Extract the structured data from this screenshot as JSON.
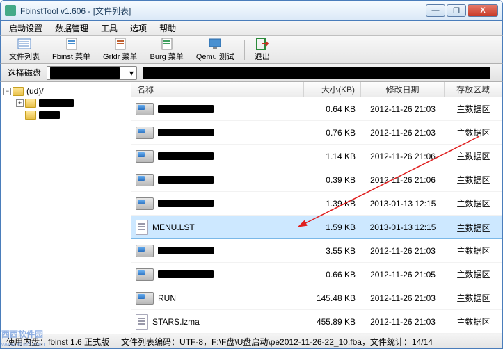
{
  "window": {
    "title": "FbinstTool v1.606 - [文件列表]",
    "min": "—",
    "max": "❐",
    "close": "X"
  },
  "menu": {
    "start": "启动设置",
    "data": "数据管理",
    "tools": "工具",
    "options": "选项",
    "help": "帮助"
  },
  "toolbar": {
    "filelist": "文件列表",
    "fbinst": "Fbinst 菜单",
    "grldr": "Grldr 菜单",
    "burg": "Burg 菜单",
    "qemu": "Qemu 测试",
    "exit": "退出"
  },
  "disk": {
    "label": "选择磁盘",
    "chevron": "▾"
  },
  "tree": {
    "root": "(ud)/",
    "minus": "−",
    "plus": "+"
  },
  "columns": {
    "name": "名称",
    "size": "大小(KB)",
    "date": "修改日期",
    "store": "存放区域"
  },
  "rows": [
    {
      "icon": "drive",
      "masked": true,
      "name": "",
      "size": "0.64 KB",
      "date": "2012-11-26 21:03",
      "store": "主数据区",
      "selected": false
    },
    {
      "icon": "drive",
      "masked": true,
      "name": "",
      "size": "0.76 KB",
      "date": "2012-11-26 21:03",
      "store": "主数据区",
      "selected": false
    },
    {
      "icon": "drive",
      "masked": true,
      "name": "",
      "size": "1.14 KB",
      "date": "2012-11-26 21:06",
      "store": "主数据区",
      "selected": false
    },
    {
      "icon": "drive",
      "masked": true,
      "name": "",
      "size": "0.39 KB",
      "date": "2012-11-26 21:06",
      "store": "主数据区",
      "selected": false
    },
    {
      "icon": "drive",
      "masked": true,
      "name": "",
      "size": "1.39 KB",
      "date": "2013-01-13 12:15",
      "store": "主数据区",
      "selected": false
    },
    {
      "icon": "doc",
      "masked": false,
      "name": "MENU.LST",
      "size": "1.59 KB",
      "date": "2013-01-13 12:15",
      "store": "主数据区",
      "selected": true
    },
    {
      "icon": "drive",
      "masked": true,
      "name": "",
      "size": "3.55 KB",
      "date": "2012-11-26 21:03",
      "store": "主数据区",
      "selected": false
    },
    {
      "icon": "drive",
      "masked": true,
      "name": "",
      "size": "0.66 KB",
      "date": "2012-11-26 21:05",
      "store": "主数据区",
      "selected": false
    },
    {
      "icon": "drive",
      "masked": false,
      "name": "RUN",
      "size": "145.48 KB",
      "date": "2012-11-26 21:03",
      "store": "主数据区",
      "selected": false
    },
    {
      "icon": "doc",
      "masked": false,
      "name": "STARS.lzma",
      "size": "455.89 KB",
      "date": "2012-11-26 21:03",
      "store": "主数据区",
      "selected": false
    }
  ],
  "status": {
    "seg1": "使用内盘：fbinst 1.6 正式版",
    "seg2": "文件列表编码：UTF-8，F:\\F盘\\U盘启动\\pe2012-11-26-22_10.fba，文件统计：14/14"
  },
  "watermark": {
    "big": "西西软件园",
    "small": "www.xihu5.com"
  }
}
